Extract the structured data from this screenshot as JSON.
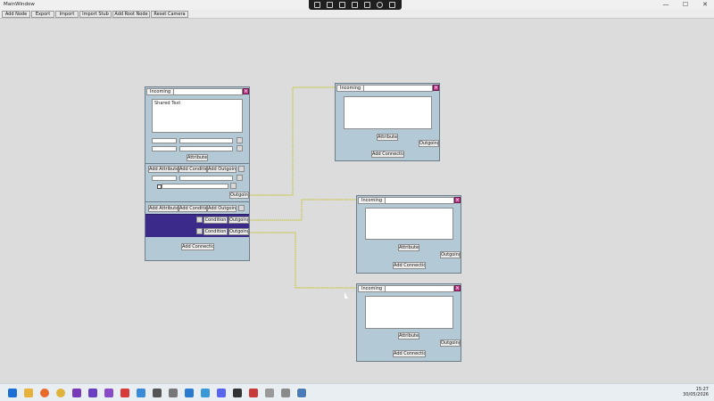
{
  "window": {
    "title": "MainWindow",
    "minimize": "—",
    "maximize": "☐",
    "close": "✕"
  },
  "toolbar": {
    "buttons": [
      "Add Node",
      "Export",
      "Import",
      "Import Stub",
      "Add Root Node",
      "Reset Camera"
    ]
  },
  "node_main": {
    "tab": "Incoming",
    "close": "×",
    "textarea_value": "Shared Text",
    "attributes_label": "Attributes",
    "section1": {
      "add_attribute": "Add Attribute",
      "add_condition": "Add Condition",
      "add_outgoing": "Add Outgoing",
      "outgoing": "Outgoing"
    },
    "section2": {
      "add_attribute": "Add Attribute",
      "add_condition": "Add Condition",
      "add_outgoing": "Add Outgoing"
    },
    "rows": [
      {
        "condition": "Condition",
        "outgoing": "Outgoing"
      },
      {
        "condition": "Condition",
        "outgoing": "Outgoing"
      }
    ],
    "add_connection": "Add Connection",
    "band_color": "#3c2a8a"
  },
  "nodes_small": [
    {
      "tab": "Incoming",
      "close": "×",
      "attributes_label": "Attributes",
      "outgoing": "Outgoing",
      "add_connection": "Add Connection"
    },
    {
      "tab": "Incoming",
      "close": "×",
      "attributes_label": "Attributes",
      "outgoing": "Outgoing",
      "add_connection": "Add Connection"
    },
    {
      "tab": "Incoming",
      "close": "×",
      "attributes_label": "Attributes",
      "outgoing": "Outgoing",
      "add_connection": "Add Connection"
    }
  ],
  "wire_color": "#c8c640",
  "taskbar": {
    "time": "15:27",
    "date": "30/05/2026",
    "icons": [
      "start-icon",
      "file-explorer-icon",
      "firefox-icon",
      "chrome-icon",
      "media-app-icon",
      "app-icon",
      "visual-studio-icon",
      "zotero-icon",
      "zoom-icon",
      "unity-icon",
      "app-icon",
      "vscode-icon",
      "app-icon",
      "discord-icon",
      "app-icon",
      "app-icon",
      "app-icon",
      "app-icon",
      "mainwindow-app-icon"
    ]
  }
}
